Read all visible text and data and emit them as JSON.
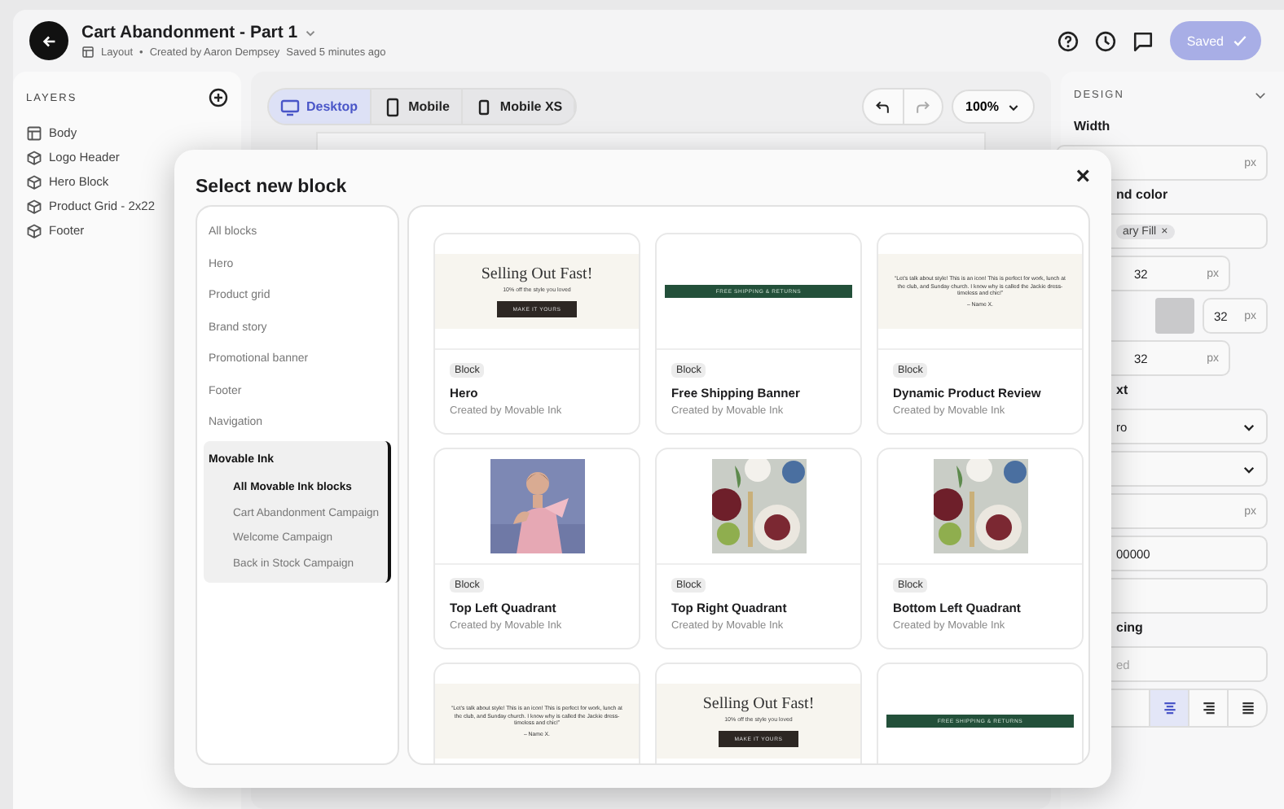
{
  "header": {
    "title": "Cart Abandonment - Part 1",
    "subtitle_type": "Layout",
    "separator": "•",
    "created_by": "Created by Aaron Dempsey",
    "saved_time": "Saved 5 minutes ago",
    "save_button": "Saved"
  },
  "layers": {
    "heading": "LAYERS",
    "items": [
      {
        "label": "Body",
        "kind": "layout"
      },
      {
        "label": "Logo Header",
        "kind": "block"
      },
      {
        "label": "Hero Block",
        "kind": "block"
      },
      {
        "label": "Product Grid - 2x22",
        "kind": "block"
      },
      {
        "label": "Footer",
        "kind": "block"
      }
    ]
  },
  "canvas": {
    "devices": [
      {
        "label": "Desktop",
        "kind": "desktop",
        "selected": true
      },
      {
        "label": "Mobile",
        "kind": "mobile",
        "selected": false
      },
      {
        "label": "Mobile XS",
        "kind": "small",
        "selected": false
      }
    ],
    "zoom": "100%"
  },
  "design_panel": {
    "heading": "DESIGN",
    "rows": [
      {
        "kind": "label",
        "text": "Width"
      },
      {
        "kind": "field",
        "unit": "px"
      },
      {
        "kind": "label",
        "text": "nd color"
      },
      {
        "kind": "chip",
        "text": "ary Fill",
        "remove": "×"
      },
      {
        "kind": "half",
        "value": "32",
        "unit": "px"
      },
      {
        "kind": "swatch",
        "value": "32",
        "unit": "px"
      },
      {
        "kind": "half",
        "value": "32",
        "unit": "px"
      },
      {
        "kind": "label",
        "text": "xt"
      },
      {
        "kind": "select",
        "value": "ro"
      },
      {
        "kind": "select"
      },
      {
        "kind": "field",
        "unit": "px"
      },
      {
        "kind": "field",
        "value": "00000"
      },
      {
        "kind": "field"
      },
      {
        "kind": "label",
        "text": "cing"
      },
      {
        "kind": "field",
        "placeholder": "ed"
      },
      {
        "kind": "align",
        "options": [
          {
            "kind": "center",
            "selected": true
          },
          {
            "kind": "right",
            "selected": false
          },
          {
            "kind": "justify",
            "selected": false
          }
        ]
      }
    ]
  },
  "modal": {
    "title": "Select new block",
    "close": "×",
    "nav": [
      {
        "label": "All blocks",
        "selected": false
      },
      {
        "label": "Hero",
        "selected": false
      },
      {
        "label": "Product grid",
        "selected": false
      },
      {
        "label": "Brand story",
        "selected": false
      },
      {
        "label": "Promotional banner",
        "selected": false
      },
      {
        "label": "Footer",
        "selected": false
      },
      {
        "label": "Navigation",
        "selected": false
      },
      {
        "label": "Movable Ink",
        "expanded": true,
        "children": [
          {
            "label": "All Movable Ink blocks",
            "selected": true
          },
          {
            "label": "Cart Abandonment Campaign",
            "selected": false
          },
          {
            "label": "Welcome Campaign",
            "selected": false
          },
          {
            "label": "Back in Stock Campaign",
            "selected": false
          }
        ]
      }
    ],
    "cards": [
      {
        "kind": "hero",
        "headline": "Selling Out Fast!",
        "subline": "10% off the style you loved",
        "cta": "MAKE IT YOURS",
        "badge": "Block",
        "name": "Hero",
        "creator": "Created by Movable Ink"
      },
      {
        "kind": "banner",
        "banner": "FREE SHIPPING & RETURNS",
        "badge": "Block",
        "name": "Free Shipping Banner",
        "creator": "Created by Movable Ink"
      },
      {
        "kind": "review",
        "quote": "“Let's talk about style! This is an icon! This is perfect for work, lunch at the club, and Sunday church. I know why is called the Jackie dress- timeless and chic!”",
        "author": "– Name X.",
        "badge": "Block",
        "name": "Dynamic Product Review",
        "creator": "Created by Movable Ink"
      },
      {
        "badge": "Block",
        "name": "Top Left Quadrant",
        "creator": "Created by Movable Ink"
      },
      {
        "badge": "Block",
        "name": "Top Right Quadrant",
        "creator": "Created by Movable Ink"
      },
      {
        "badge": "Block",
        "name": "Bottom Left Quadrant",
        "creator": "Created by Movable Ink"
      },
      {
        "kind": "review",
        "quote": "“Let's talk about style! This is an icon! This is perfect for work, lunch at the club, and Sunday church. I know why is called the Jackie dress- timeless and chic!”",
        "author": "– Name X."
      },
      {
        "kind": "hero",
        "headline": "Selling Out Fast!",
        "subline": "10% off the style you loved",
        "cta": "MAKE IT YOURS"
      },
      {
        "kind": "banner",
        "banner": "FREE SHIPPING & RETURNS"
      }
    ]
  }
}
